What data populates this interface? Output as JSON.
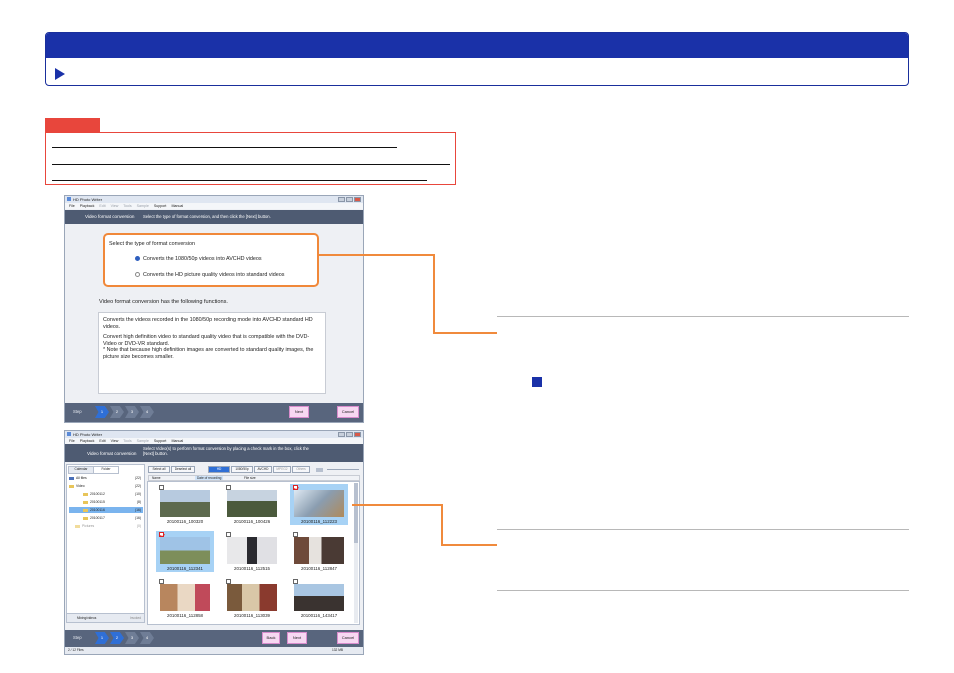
{
  "window1": {
    "title": "HD Photo Writer",
    "menu": [
      "File",
      "Playback",
      "Edit",
      "View",
      "Tools",
      "Sample",
      "Support",
      "Manual"
    ],
    "header_title": "Video format conversion",
    "header_instruction": "Select the type of format conversion, and then click the [Next] button.",
    "select_heading": "Select the type of format conversion",
    "options": [
      {
        "label": "Converts the 1080/50p videos into AVCHD videos",
        "selected": true
      },
      {
        "label": "Converts the HD picture quality videos into standard videos",
        "selected": false
      }
    ],
    "functions_heading": "Video format conversion has the following functions.",
    "info_para1": "Converts the videos recorded in the 1080/50p recording mode into AVCHD standard HD videos.",
    "info_para2": "Convert high definition video to standard quality video that is compatible with the DVD-Video or DVD-VR standard.",
    "info_para3": "* Note that because high definition images are converted to standard quality images, the picture size becomes smaller.",
    "steps_label": "Step",
    "steps": [
      "1",
      "2",
      "3",
      "4"
    ],
    "next_label": "Next",
    "cancel_label": "Cancel"
  },
  "window2": {
    "title": "HD Photo Writer",
    "menu": [
      "File",
      "Playback",
      "Edit",
      "View",
      "Tools",
      "Sample",
      "Support",
      "Manual"
    ],
    "header_title": "Video format conversion",
    "header_instruction": "Select Video(s) to perform format conversion by placing a check mark in the box, click the [Next] button.",
    "tab_calendar": "Calendar",
    "tab_folder": "Folder",
    "tree": [
      {
        "label": "All files",
        "count": "(22)"
      },
      {
        "label": "Video",
        "count": "(22)"
      },
      {
        "label": "20100112",
        "count": "(10)"
      },
      {
        "label": "20100115",
        "count": "(8)"
      },
      {
        "label": "20100116",
        "count": "(16)"
      },
      {
        "label": "20100117",
        "count": "(16)"
      },
      {
        "label": "Pictures",
        "count": "(0)"
      }
    ],
    "select_all": "Select all",
    "deselect_all": "Deselect all",
    "filters": [
      "HD",
      "1080/50p",
      "AVCHD",
      "MPEG2",
      "Others"
    ],
    "sort_labels": [
      "Name",
      "Date of recording",
      "File size"
    ],
    "thumbnails": [
      {
        "name": "20100116_100320",
        "checked": false,
        "selected": false
      },
      {
        "name": "20100116_100426",
        "checked": false,
        "selected": false
      },
      {
        "name": "20100116_112223",
        "checked": true,
        "selected": true
      },
      {
        "name": "20100116_112341",
        "checked": true,
        "selected": true
      },
      {
        "name": "20100116_112515",
        "checked": false,
        "selected": false
      },
      {
        "name": "20100116_112847",
        "checked": false,
        "selected": false
      },
      {
        "name": "20100116_112858",
        "checked": false,
        "selected": false
      },
      {
        "name": "20100116_113039",
        "checked": false,
        "selected": false
      },
      {
        "name": "20100116_143417",
        "checked": false,
        "selected": false
      }
    ],
    "bottom_tab": "Mixing/videos",
    "bottom_tab2": "Invoked",
    "steps_label": "Step",
    "steps": [
      "1",
      "2",
      "3",
      "4"
    ],
    "back_label": "Back",
    "next_label": "Next",
    "cancel_label": "Cancel",
    "status_left": "2 / 12 Files",
    "status_right": "132 MB"
  },
  "colors": {
    "banner_blue": "#1a31a8",
    "note_red": "#e8463c",
    "connector_orange": "#f08a3c",
    "header_slate": "#4e5b72",
    "accent_blue": "#2f6fd6"
  }
}
